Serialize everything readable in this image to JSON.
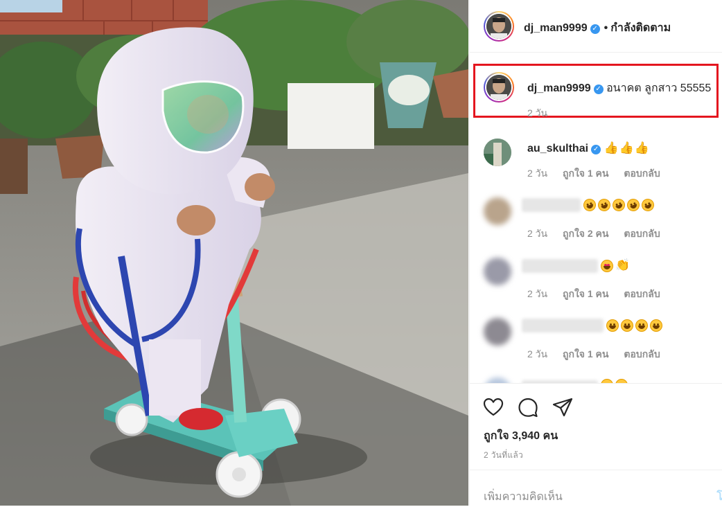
{
  "post": {
    "author": "dj_man9999",
    "follow_status": "กำลังติดตาม",
    "dot": "•",
    "caption_text": "อนาคต ลูกสาว 55555",
    "caption_time": "2 วัน"
  },
  "comments": [
    {
      "username": "au_skulthai",
      "time": "2 วัน",
      "likes": "ถูกใจ 1 คน",
      "reply": "ตอบกลับ"
    },
    {
      "username": "",
      "time": "2 วัน",
      "likes": "ถูกใจ 2 คน",
      "reply": "ตอบกลับ"
    },
    {
      "username": "",
      "time": "2 วัน",
      "likes": "ถูกใจ 1 คน",
      "reply": "ตอบกลับ"
    },
    {
      "username": "",
      "time": "2 วัน",
      "likes": "ถูกใจ 1 คน",
      "reply": "ตอบกลับ"
    }
  ],
  "icons": {
    "like": "heart-icon",
    "comment": "comment-icon",
    "share": "share-icon",
    "verified": "verified-badge-icon"
  },
  "stats": {
    "likes": "ถูกใจ 3,940 คน",
    "posted": "2 วันที่แล้ว"
  },
  "add_comment": {
    "placeholder": "เพิ่มความคิดเห็น",
    "post_label": "โ"
  },
  "colors": {
    "highlight_box": "#e4161f",
    "verified": "#3897f0",
    "muted_text": "#8e8e8e"
  }
}
